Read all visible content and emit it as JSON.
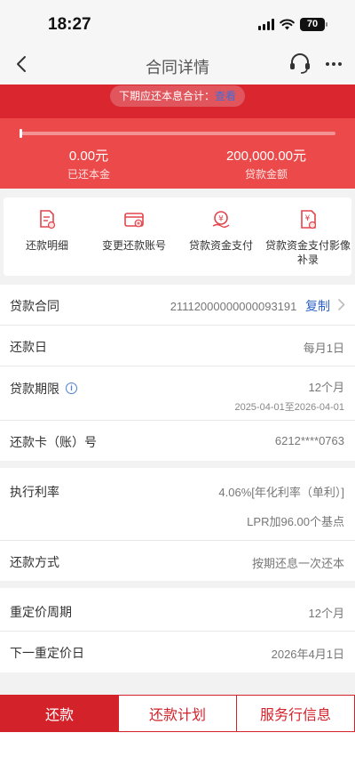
{
  "status_bar": {
    "time": "18:27",
    "battery": "70"
  },
  "nav": {
    "title": "合同详情"
  },
  "notice": {
    "text": "下期应还本息合计：",
    "link": "查看"
  },
  "summary": {
    "repaid_principal": "0.00元",
    "repaid_principal_label": "已还本金",
    "loan_amount": "200,000.00元",
    "loan_amount_label": "贷款金额",
    "progress_fraction": 0.0
  },
  "quick_actions": [
    {
      "label": "还款明细",
      "icon": "repayment-detail-icon"
    },
    {
      "label": "变更还款账号",
      "icon": "change-account-icon"
    },
    {
      "label": "贷款资金支付",
      "icon": "fund-payment-icon"
    },
    {
      "label": "贷款资金支付影像补录",
      "icon": "image-supplement-icon"
    }
  ],
  "contract": {
    "label": "贷款合同",
    "number": "21112000000000093191",
    "copy": "复制"
  },
  "repay_day": {
    "label": "还款日",
    "value": "每月1日"
  },
  "term": {
    "label": "贷款期限",
    "value": "12个月",
    "range": "2025-04-01至2026-04-01"
  },
  "card": {
    "label": "还款卡（账）号",
    "value": "6212****0763"
  },
  "rate": {
    "label": "执行利率",
    "value": "4.06%[年化利率（单利）]",
    "sub": "LPR加96.00个基点"
  },
  "method": {
    "label": "还款方式",
    "value": "按期还息一次还本"
  },
  "reprice_cycle": {
    "label": "重定价周期",
    "value": "12个月"
  },
  "next_reprice": {
    "label": "下一重定价日",
    "value": "2026年4月1日"
  },
  "buttons": {
    "repay": "还款",
    "plan": "还款计划",
    "bank_info": "服务行信息"
  },
  "colors": {
    "brand_red": "#d4222b",
    "banner_red": "#ec4a4a",
    "link_blue": "#2d62c9"
  }
}
